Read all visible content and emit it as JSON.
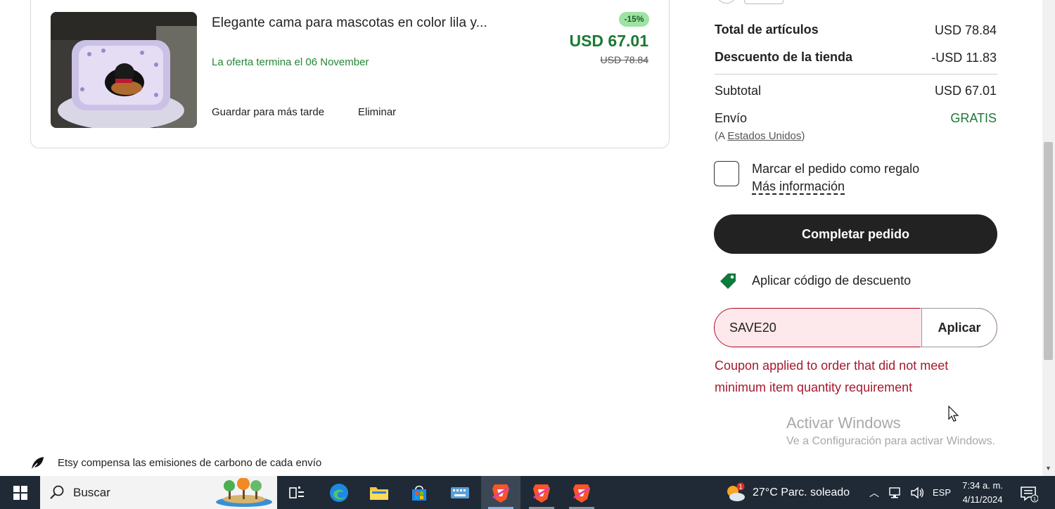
{
  "cart_item": {
    "title": "Elegante cama para mascotas en color lila y...",
    "offer_text": "La oferta termina el 06 November",
    "discount_badge": "-15%",
    "sale_price": "USD 67.01",
    "original_price": "USD 78.84",
    "save_later_label": "Guardar para más tarde",
    "remove_label": "Eliminar"
  },
  "summary": {
    "items_total_label": "Total de artículos",
    "items_total_value": "USD 78.84",
    "shop_discount_label": "Descuento de la tienda",
    "shop_discount_value": "-USD 11.83",
    "subtotal_label": "Subtotal",
    "subtotal_value": "USD 67.01",
    "shipping_label": "Envío",
    "shipping_value": "GRATIS",
    "ship_prefix": "(A ",
    "ship_country": "Estados Unidos",
    "ship_suffix": ")",
    "gift_label": "Marcar el pedido como regalo",
    "more_info_label": "Más información",
    "checkout_label": "Completar pedido",
    "coupon_toggle_label": "Aplicar código de descuento",
    "coupon_value": "SAVE20",
    "coupon_apply_label": "Aplicar",
    "coupon_error": "Coupon applied to order that did not meet minimum item quantity requirement"
  },
  "footer": {
    "carbon_note": "Etsy compensa las emisiones de carbono de cada envío"
  },
  "windows_watermark": {
    "title": "Activar Windows",
    "subtitle": "Ve a Configuración para activar Windows."
  },
  "taskbar": {
    "search_placeholder": "Buscar",
    "weather_text": "27°C  Parc. soleado",
    "weather_badge": "1",
    "language": "ESP",
    "time": "7:34 a. m.",
    "date": "4/11/2024"
  },
  "colors": {
    "accent_green": "#1b7a33",
    "error_red": "#a61a2e",
    "button_dark": "#222222",
    "taskbar_bg": "#1f2a36"
  }
}
